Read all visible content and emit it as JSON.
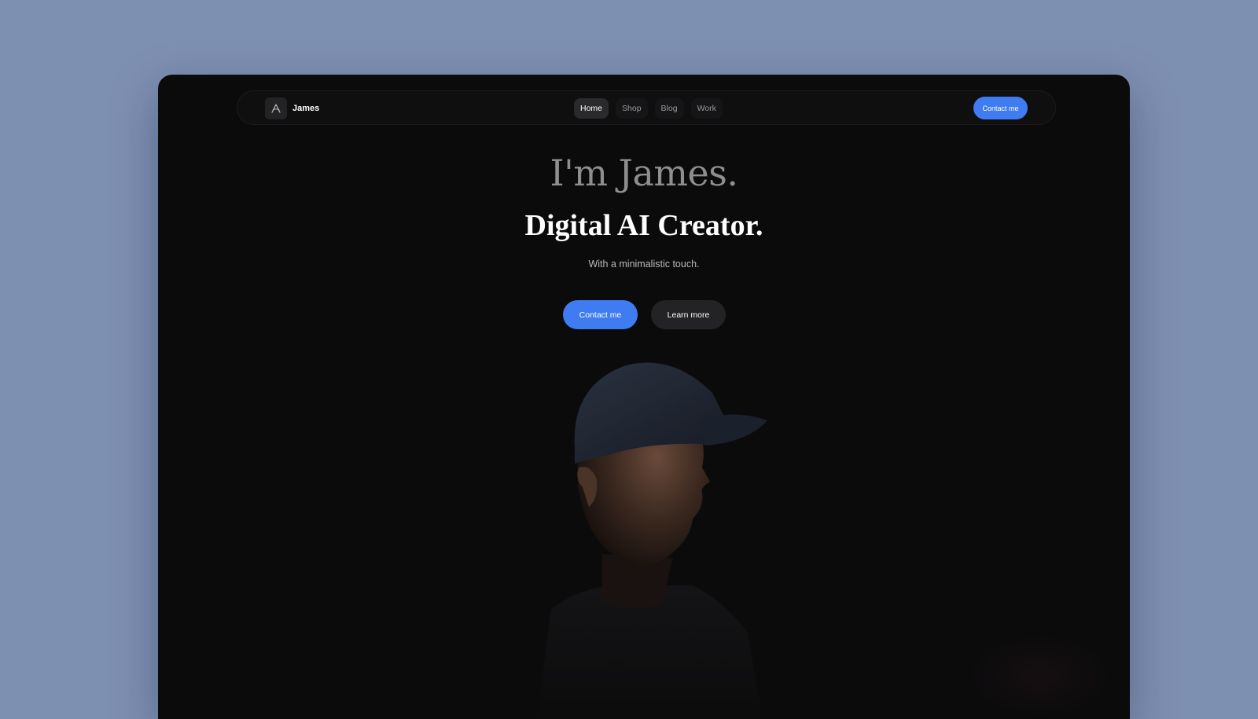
{
  "brand": {
    "name": "James",
    "logo_icon": "brand-logo-icon"
  },
  "nav": {
    "items": [
      {
        "label": "Home",
        "active": true
      },
      {
        "label": "Shop",
        "active": false
      },
      {
        "label": "Blog",
        "active": false
      },
      {
        "label": "Work",
        "active": false
      }
    ],
    "cta_label": "Contact me"
  },
  "hero": {
    "greeting": "I'm James.",
    "title": "Digital AI Creator.",
    "subtitle": "With a minimalistic touch.",
    "primary_label": "Contact me",
    "secondary_label": "Learn more"
  },
  "colors": {
    "page_background": "#7e90b2",
    "window_background": "#0b0b0c",
    "accent": "#3f7cf1"
  }
}
